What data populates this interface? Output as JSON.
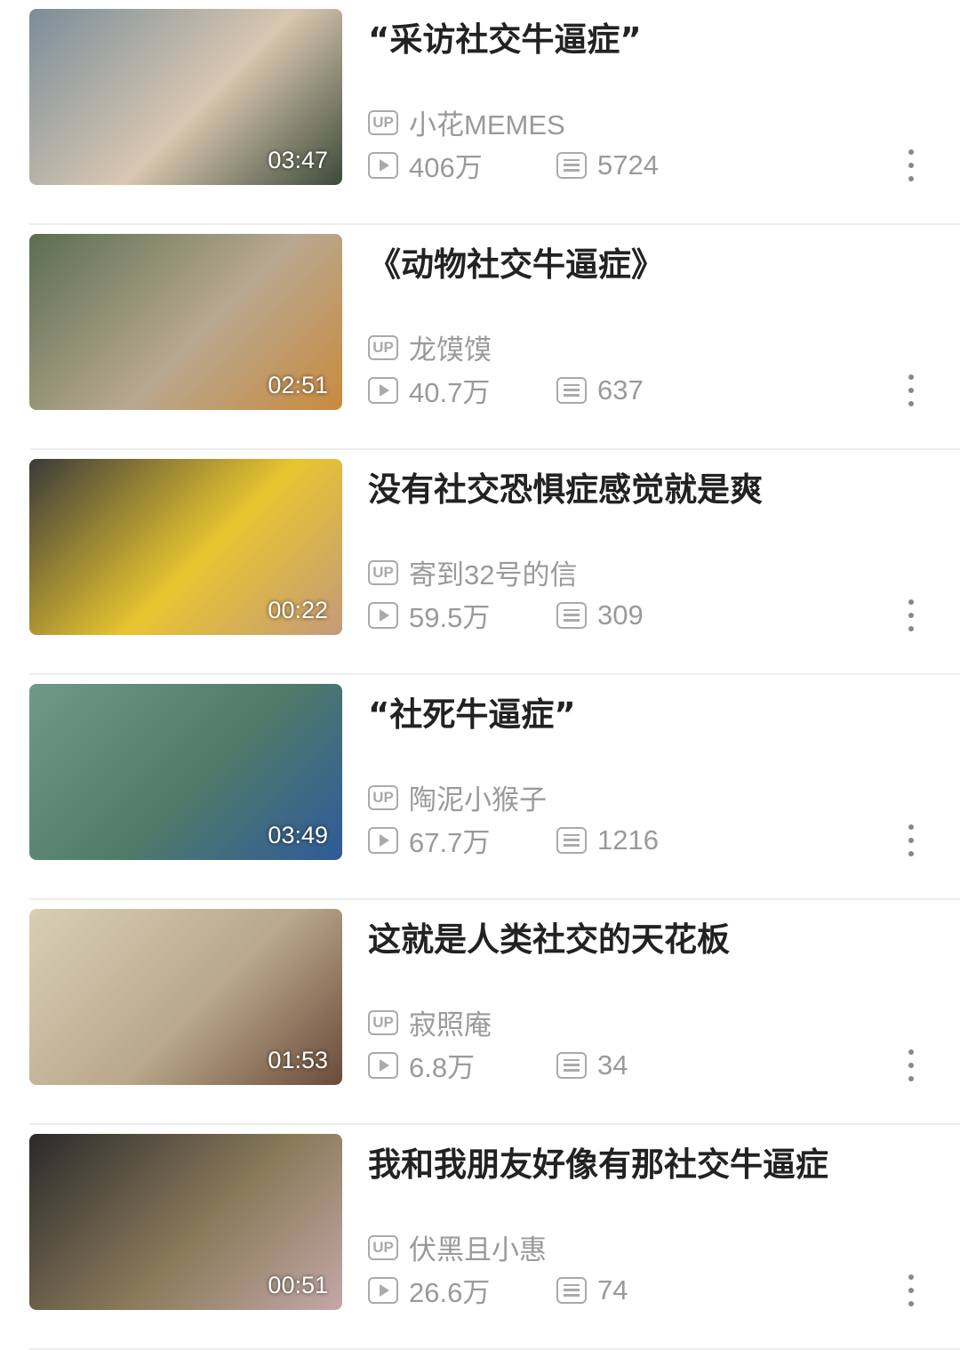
{
  "videos": [
    {
      "title": "“采访社交牛逼症”",
      "uploader": "小花MEMES",
      "views": "406万",
      "danmaku": "5724",
      "duration": "03:47",
      "thumb_colors": [
        "#7a8d9a",
        "#d9c7b0",
        "#3d4a3a"
      ]
    },
    {
      "title": "《动物社交牛逼症》",
      "uploader": "龙馍馍",
      "views": "40.7万",
      "danmaku": "637",
      "duration": "02:51",
      "thumb_colors": [
        "#5b6e4f",
        "#b8a890",
        "#c98a3d"
      ]
    },
    {
      "title": "没有社交恐惧症感觉就是爽",
      "uploader": "寄到32号的信",
      "views": "59.5万",
      "danmaku": "309",
      "duration": "00:22",
      "thumb_colors": [
        "#3a3a3a",
        "#e8c530",
        "#c49a7a"
      ]
    },
    {
      "title": "“社死牛逼症”",
      "uploader": "陶泥小猴子",
      "views": "67.7万",
      "danmaku": "1216",
      "duration": "03:49",
      "thumb_colors": [
        "#6f9a8a",
        "#4f7a6a",
        "#2f5a9a"
      ]
    },
    {
      "title": "这就是人类社交的天花板",
      "uploader": "寂照庵",
      "views": "6.8万",
      "danmaku": "34",
      "duration": "01:53",
      "thumb_colors": [
        "#d8cfb8",
        "#b9a88a",
        "#6a4a3a"
      ]
    },
    {
      "title": "我和我朋友好像有那社交牛逼症",
      "uploader": "伏黑且小惠",
      "views": "26.6万",
      "danmaku": "74",
      "duration": "00:51",
      "thumb_colors": [
        "#2a2a2a",
        "#8a7a5a",
        "#c4a8a8"
      ]
    }
  ],
  "labels": {
    "up_badge": "UP"
  }
}
